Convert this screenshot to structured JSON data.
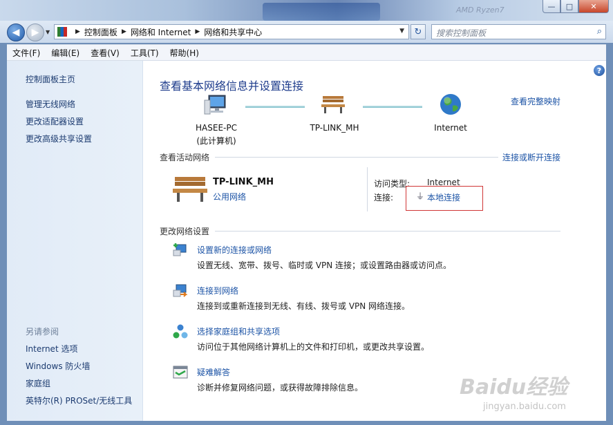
{
  "window": {
    "background_text": "AMD Ryzen7",
    "controls": {
      "minimize": "—",
      "maximize": "□",
      "close": "✕"
    }
  },
  "addressbar": {
    "breadcrumb": [
      "控制面板",
      "网络和 Internet",
      "网络和共享中心"
    ],
    "search_placeholder": "搜索控制面板"
  },
  "menu": [
    "文件(F)",
    "编辑(E)",
    "查看(V)",
    "工具(T)",
    "帮助(H)"
  ],
  "sidebar": {
    "home": "控制面板主页",
    "tasks": [
      "管理无线网络",
      "更改适配器设置",
      "更改高级共享设置"
    ],
    "see_also_heading": "另请参阅",
    "see_also": [
      "Internet 选项",
      "Windows 防火墙",
      "家庭组",
      "英特尔(R) PROSet/无线工具"
    ]
  },
  "main": {
    "title": "查看基本网络信息并设置连接",
    "view_full_map": "查看完整映射",
    "map": {
      "computer_name": "HASEE-PC",
      "computer_sub": "(此计算机)",
      "network_name": "TP-LINK_MH",
      "internet": "Internet"
    },
    "active_networks": {
      "heading": "查看活动网络",
      "connect_link": "连接或断开连接",
      "name": "TP-LINK_MH",
      "category": "公用网络",
      "access_type_label": "访问类型:",
      "access_type_value": "Internet",
      "connections_label": "连接:",
      "connections_value": "本地连接"
    },
    "change_settings": {
      "heading": "更改网络设置",
      "tasks": [
        {
          "title": "设置新的连接或网络",
          "desc": "设置无线、宽带、拨号、临时或 VPN 连接；或设置路由器或访问点。"
        },
        {
          "title": "连接到网络",
          "desc": "连接到或重新连接到无线、有线、拨号或 VPN 网络连接。"
        },
        {
          "title": "选择家庭组和共享选项",
          "desc": "访问位于其他网络计算机上的文件和打印机，或更改共享设置。"
        },
        {
          "title": "疑难解答",
          "desc": "诊断并修复网络问题，或获得故障排除信息。"
        }
      ]
    }
  },
  "watermark": {
    "main": "Baidu经验",
    "sub": "jingyan.baidu.com"
  },
  "colors": {
    "link": "#1d54a6",
    "title": "#1e3c8c",
    "highlight_border": "#d03535"
  }
}
